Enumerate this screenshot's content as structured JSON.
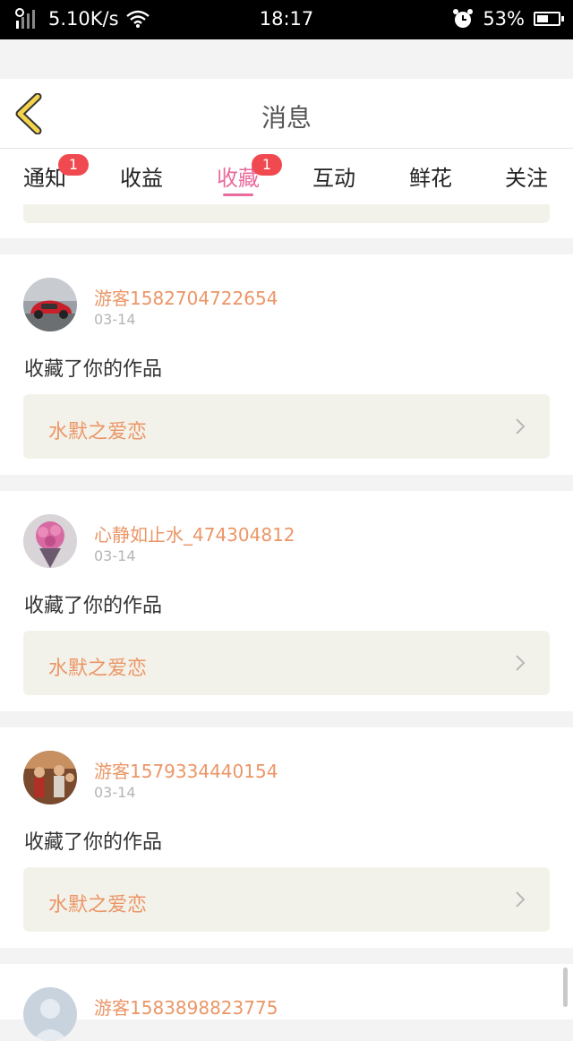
{
  "status_bar": {
    "net_speed": "5.10K/s",
    "time": "18:17",
    "battery": "53%",
    "battery_level": 0.53
  },
  "header": {
    "title": "消息",
    "back_icon": "chevron-left-icon"
  },
  "tabs": [
    {
      "label": "通知",
      "badge": "1"
    },
    {
      "label": "收益",
      "badge": ""
    },
    {
      "label": "收藏",
      "badge": "1",
      "active": true
    },
    {
      "label": "互动",
      "badge": ""
    },
    {
      "label": "鲜花",
      "badge": ""
    },
    {
      "label": "关注",
      "badge": ""
    }
  ],
  "colors": {
    "accent_pink": "#e86b9b",
    "username_orange": "#eb9667",
    "badge_red": "#f0494f",
    "work_box_bg": "#f3f2ea"
  },
  "messages": [
    {
      "user": "游客1582704722654",
      "date": "03-14",
      "action": "收藏了你的作品",
      "work": "水默之爱恋",
      "avatar": "red-car-avatar"
    },
    {
      "user": "心静如止水_474304812",
      "date": "03-14",
      "action": "收藏了你的作品",
      "work": "水默之爱恋",
      "avatar": "flowers-avatar"
    },
    {
      "user": "游客1579334440154",
      "date": "03-14",
      "action": "收藏了你的作品",
      "work": "水默之爱恋",
      "avatar": "people-avatar"
    },
    {
      "user": "游客1583898823775",
      "date": "",
      "action": "",
      "work": "",
      "avatar": "default-avatar"
    }
  ]
}
